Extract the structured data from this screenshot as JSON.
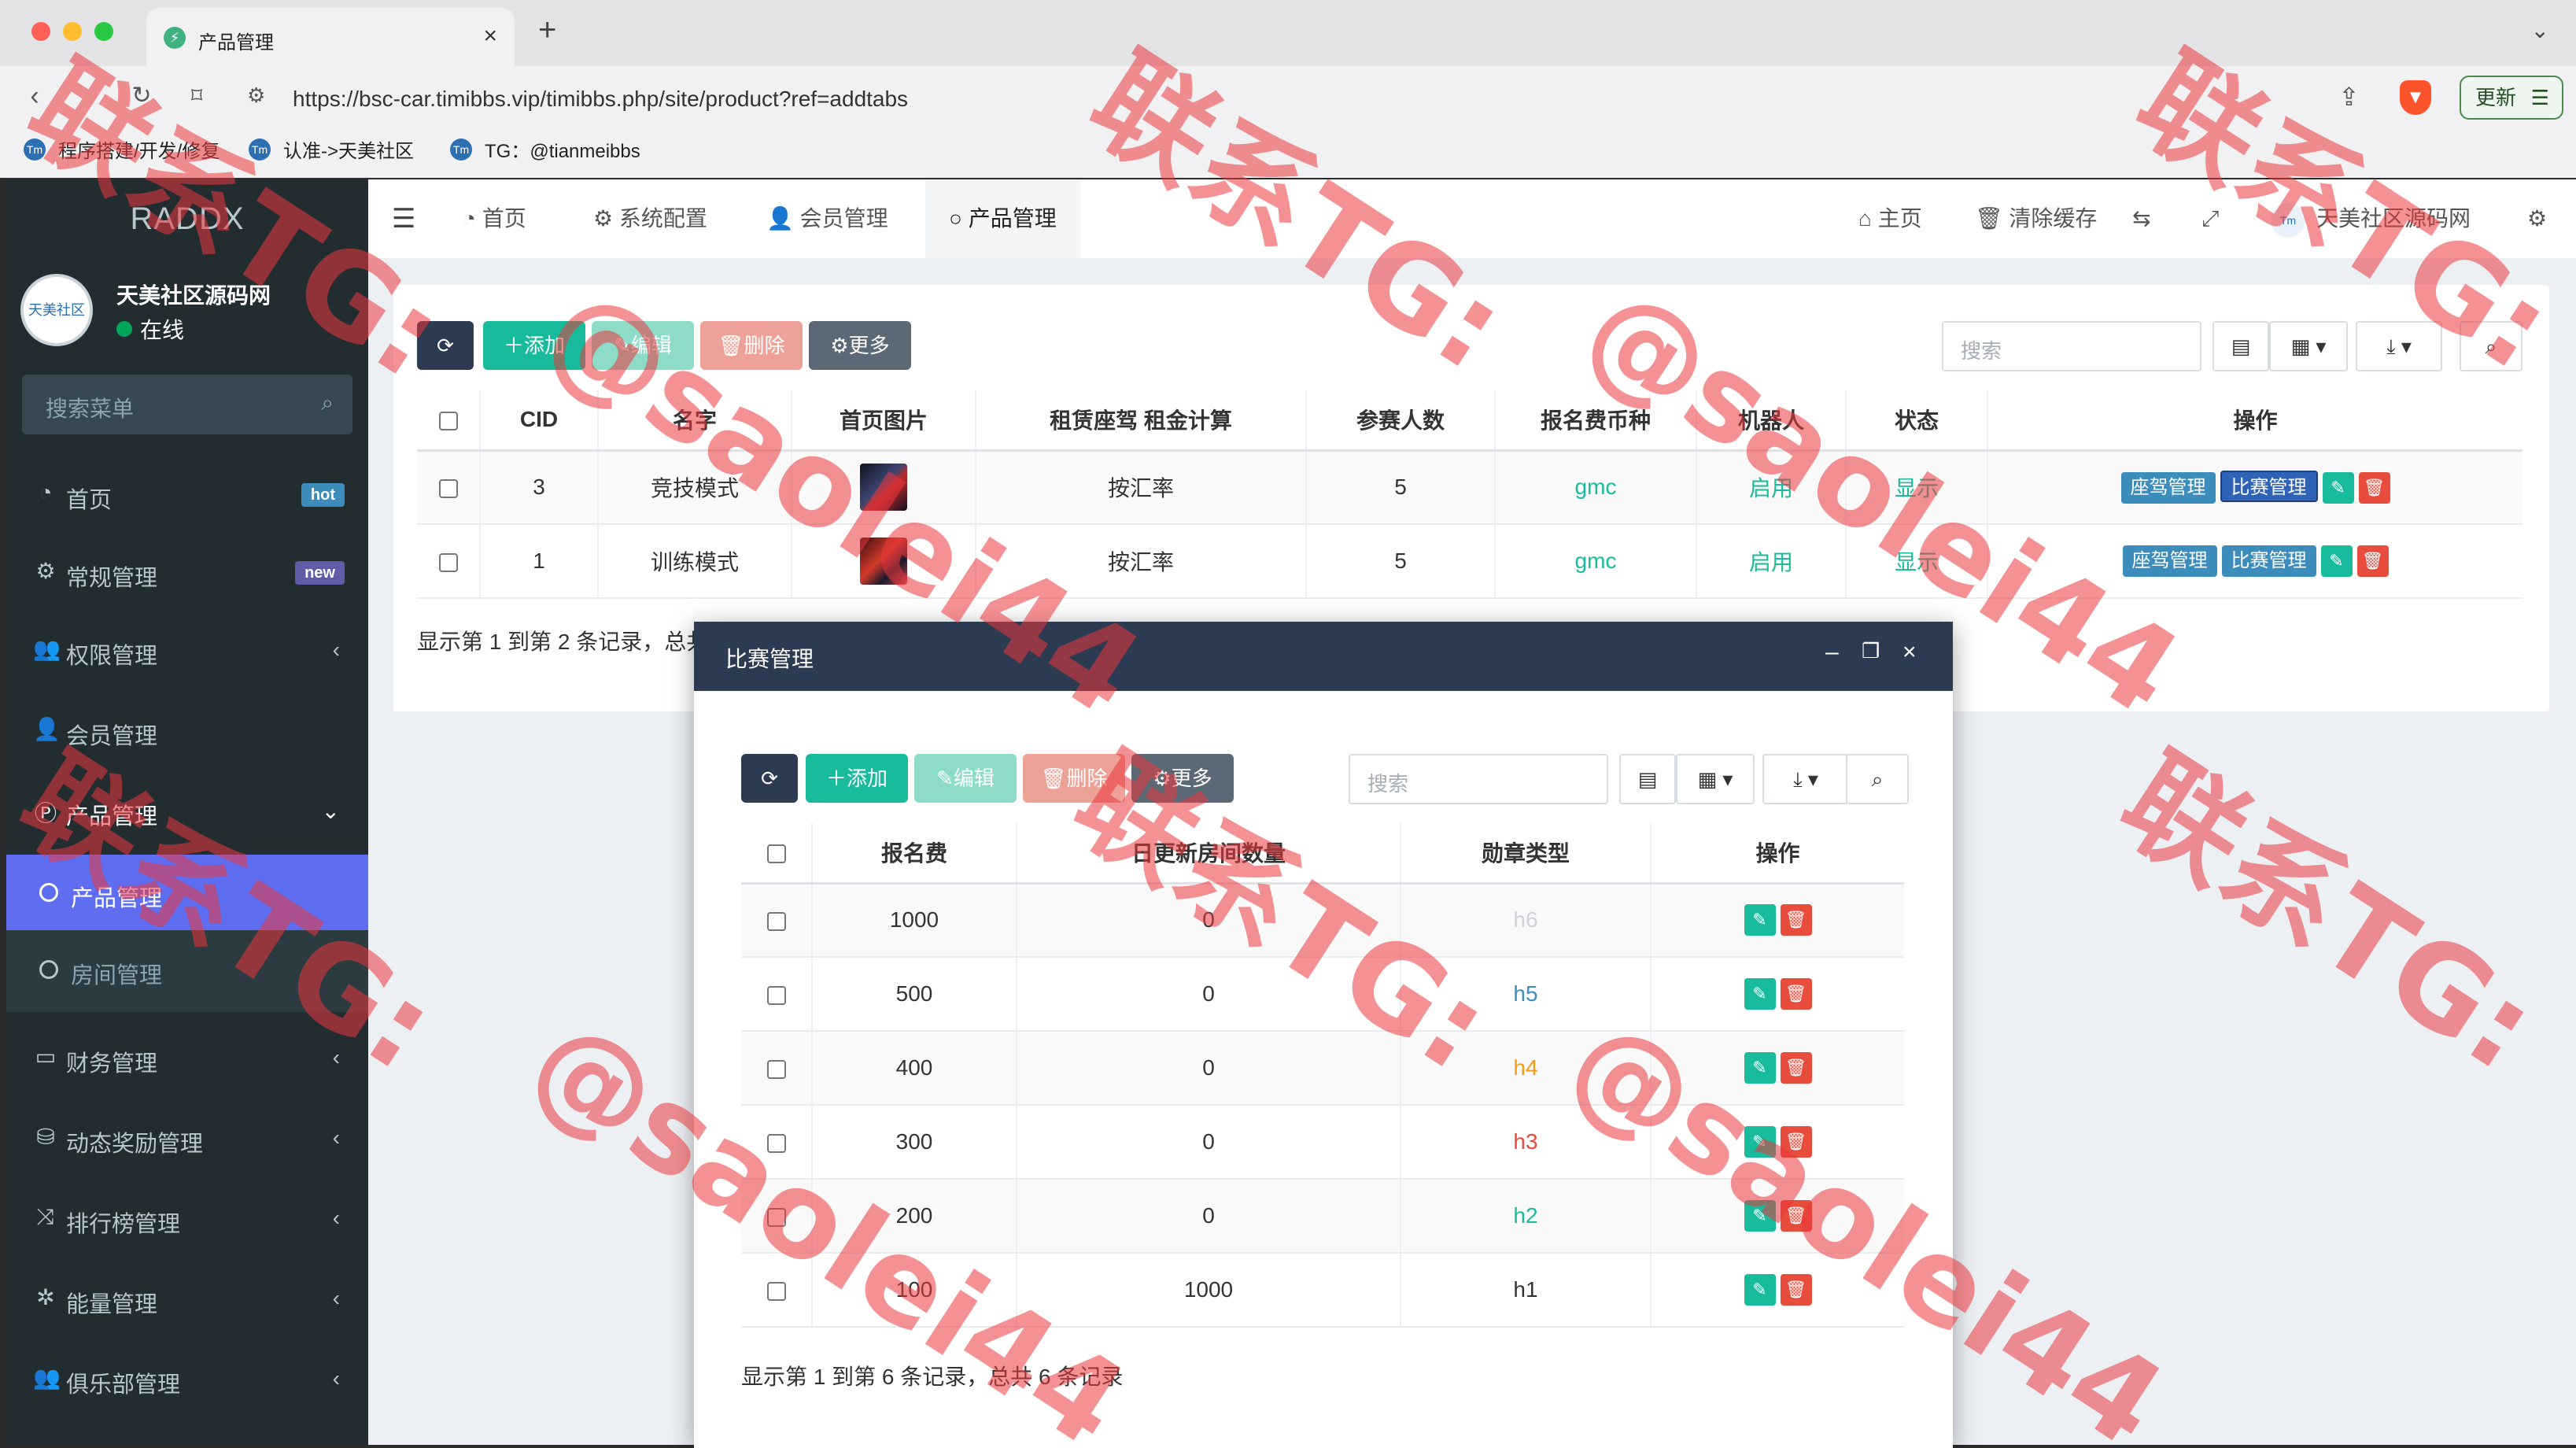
{
  "browser": {
    "tab_title": "产品管理",
    "tab_close": "×",
    "new_tab": "+",
    "url": "https://bsc-car.timibbs.vip/timibbs.php/site/product?ref=addtabs",
    "update_label": "更新",
    "bookmarks": [
      "程序搭建/开发/修复",
      "认准->天美社区",
      "TG：@tianmeibbs"
    ]
  },
  "sidebar": {
    "logo": "RADDX",
    "user_name": "天美社区源码网",
    "user_status": "在线",
    "avatar_text": "天美社区",
    "search_placeholder": "搜索菜单",
    "items": [
      {
        "label": "首页",
        "badge": "hot"
      },
      {
        "label": "常规管理",
        "badge": "new"
      },
      {
        "label": "权限管理"
      },
      {
        "label": "会员管理"
      },
      {
        "label": "产品管理"
      },
      {
        "label": "财务管理"
      },
      {
        "label": "动态奖励管理"
      },
      {
        "label": "排行榜管理"
      },
      {
        "label": "能量管理"
      },
      {
        "label": "俱乐部管理"
      }
    ],
    "sub_items": [
      {
        "label": "产品管理"
      },
      {
        "label": "房间管理"
      }
    ]
  },
  "topnav": {
    "tabs": [
      {
        "label": "首页"
      },
      {
        "label": "系统配置"
      },
      {
        "label": "会员管理"
      },
      {
        "label": "产品管理"
      }
    ],
    "home_label": "主页",
    "clear_cache_label": "清除缓存",
    "site_name": "天美社区源码网"
  },
  "toolbar": {
    "add": "添加",
    "edit": "编辑",
    "delete": "删除",
    "more": "更多",
    "search_placeholder": "搜索"
  },
  "product_table": {
    "headers": [
      "CID",
      "名字",
      "首页图片",
      "租赁座驾 租金计算",
      "参赛人数",
      "报名费币种",
      "机器人",
      "状态",
      "操作"
    ],
    "rows": [
      {
        "cid": "3",
        "name": "竞技模式",
        "calc": "按汇率",
        "players": "5",
        "currency": "gmc",
        "robot": "启用",
        "status": "显示"
      },
      {
        "cid": "1",
        "name": "训练模式",
        "calc": "按汇率",
        "players": "5",
        "currency": "gmc",
        "robot": "启用",
        "status": "显示"
      }
    ],
    "action_car": "座驾管理",
    "action_match": "比赛管理",
    "pager": "显示第 1 到第 2 条记录，总共 2 条记录"
  },
  "modal": {
    "title": "比赛管理",
    "headers": [
      "报名费",
      "日更新房间数量",
      "勋章类型",
      "操作"
    ],
    "rows": [
      {
        "fee": "1000",
        "rooms": "0",
        "medal": "h6",
        "color": "#cfd3d8"
      },
      {
        "fee": "500",
        "rooms": "0",
        "medal": "h5",
        "color": "#3c8dbc"
      },
      {
        "fee": "400",
        "rooms": "0",
        "medal": "h4",
        "color": "#f39c12"
      },
      {
        "fee": "300",
        "rooms": "0",
        "medal": "h3",
        "color": "#e74c3c"
      },
      {
        "fee": "200",
        "rooms": "0",
        "medal": "h2",
        "color": "#18bc9c"
      },
      {
        "fee": "100",
        "rooms": "1000",
        "medal": "h1",
        "color": "#333333"
      }
    ],
    "pager": "显示第 1 到第 6 条记录，总共 6 条记录"
  },
  "watermark": [
    "联系TG:",
    "@saolei44"
  ]
}
